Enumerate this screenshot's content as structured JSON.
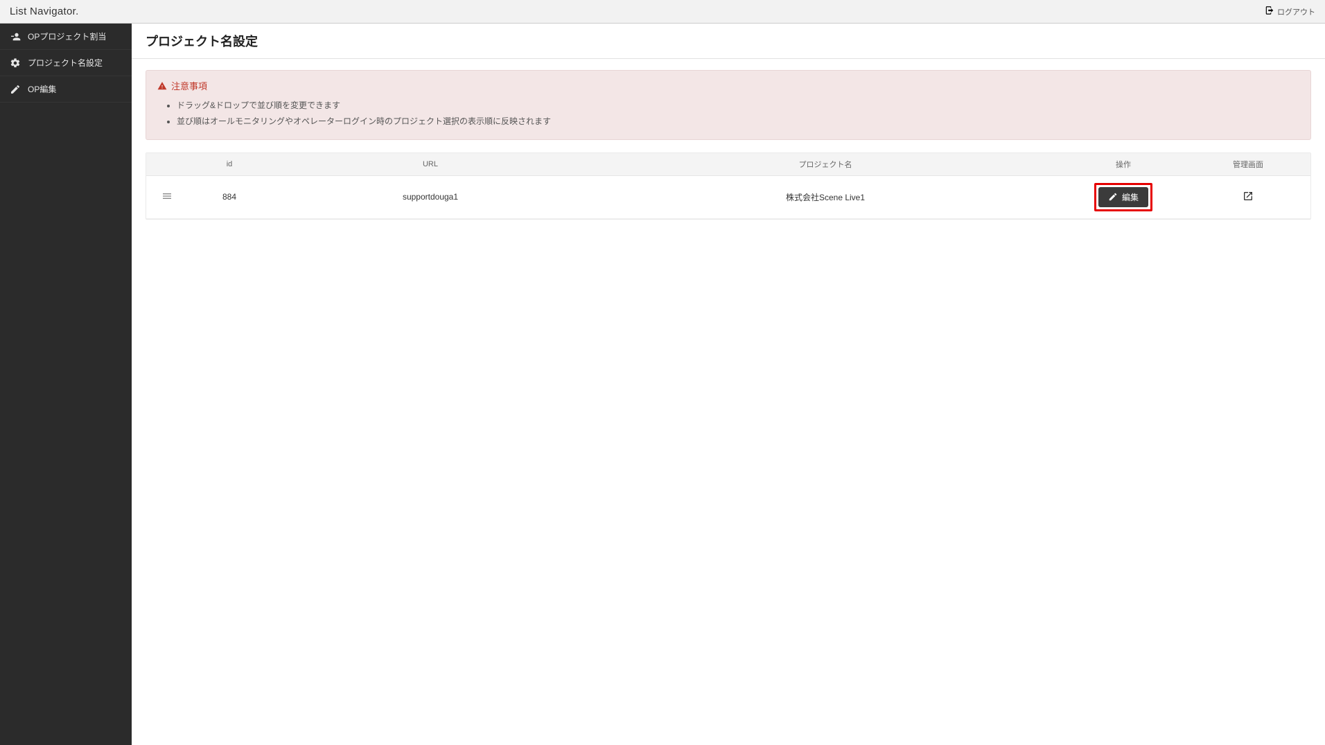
{
  "header": {
    "brand": "List Navigator.",
    "logout_label": "ログアウト"
  },
  "sidebar": {
    "items": [
      {
        "label": "OPプロジェクト割当"
      },
      {
        "label": "プロジェクト名設定"
      },
      {
        "label": "OP編集"
      }
    ]
  },
  "page": {
    "title": "プロジェクト名設定"
  },
  "notice": {
    "title": "注意事項",
    "items": [
      "ドラッグ&ドロップで並び順を変更できます",
      "並び順はオールモニタリングやオペレーターログイン時のプロジェクト選択の表示順に反映されます"
    ]
  },
  "table": {
    "columns": {
      "id": "id",
      "url": "URL",
      "project_name": "プロジェクト名",
      "action": "操作",
      "admin": "管理画面"
    },
    "rows": [
      {
        "id": "884",
        "url": "supportdouga1",
        "project_name": "株式会社Scene Live1",
        "edit_label": "編集"
      }
    ]
  }
}
